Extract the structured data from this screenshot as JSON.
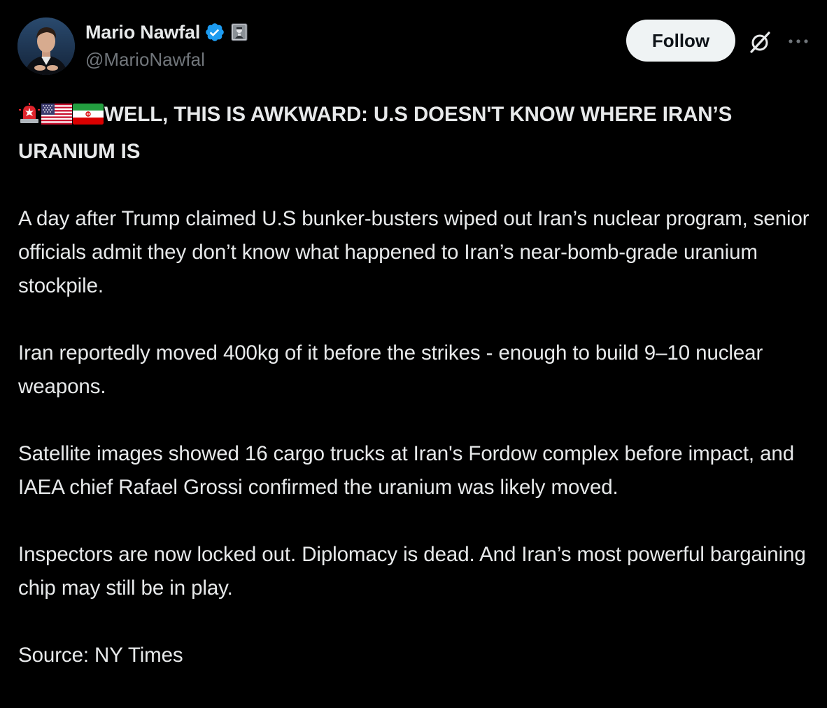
{
  "author": {
    "display_name": "Mario Nawfal",
    "handle": "@MarioNawfal",
    "verified_color": "#1d9bf0"
  },
  "actions": {
    "follow_label": "Follow",
    "grok_icon": "grok-icon",
    "more_icon": "more-icon"
  },
  "tweet": {
    "headline": "WELL, THIS IS AWKWARD: U.S DOESN'T KNOW WHERE IRAN’S URANIUM IS",
    "paragraphs": [
      "A day after Trump claimed U.S bunker-busters wiped out Iran’s nuclear program, senior officials admit they don’t know what happened to Iran’s near-bomb-grade uranium stockpile.",
      "Iran reportedly moved 400kg of it before the strikes - enough to build 9–10 nuclear weapons.",
      "Satellite images showed 16 cargo trucks at Iran's Fordow complex before impact, and IAEA chief Rafael Grossi confirmed the uranium was likely moved.",
      "Inspectors are now locked out. Diplomacy is dead. And Iran’s most powerful bargaining chip may still be in play.",
      "Source: NY Times"
    ],
    "emojis": [
      "police-light-emoji",
      "us-flag-emoji",
      "iran-flag-emoji"
    ]
  },
  "colors": {
    "background": "#000000",
    "text": "#e7e9ea",
    "secondary_text": "#71767b",
    "follow_bg": "#eff3f4"
  }
}
